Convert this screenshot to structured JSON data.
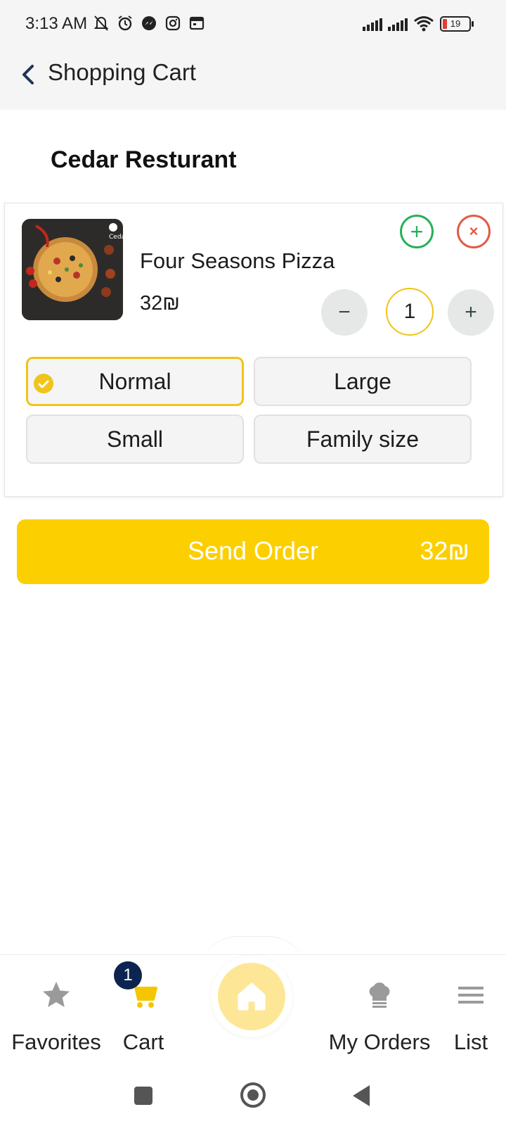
{
  "status_bar": {
    "time": "3:13 AM",
    "icons_left": [
      "bell-off-icon",
      "alarm-icon",
      "messenger-icon",
      "instagram-icon",
      "calendar-icon"
    ],
    "battery": "19"
  },
  "header": {
    "title": "Shopping Cart",
    "back_icon": "chevron-left-icon"
  },
  "restaurant": {
    "name": "Cedar Resturant"
  },
  "cart_item": {
    "name": "Four Seasons Pizza",
    "price": "32₪",
    "quantity": "1",
    "minus_label": "−",
    "plus_label": "+",
    "add_label": "+",
    "remove_label": "×",
    "image_logo": "Cedar",
    "sizes": [
      {
        "label": "Normal",
        "selected": true
      },
      {
        "label": "Large",
        "selected": false
      },
      {
        "label": "Small",
        "selected": false
      },
      {
        "label": "Family size",
        "selected": false
      }
    ]
  },
  "send_order": {
    "label": "Send Order",
    "total": "32₪"
  },
  "bottom_nav": {
    "cart_badge": "1",
    "items": [
      {
        "label": "Favorites",
        "icon": "star-icon"
      },
      {
        "label": "Cart",
        "icon": "cart-icon"
      },
      {
        "label": "",
        "icon": "home-icon"
      },
      {
        "label": "My Orders",
        "icon": "chef-hat-icon"
      },
      {
        "label": "List",
        "icon": "menu-icon"
      }
    ]
  },
  "colors": {
    "accent": "#fccf00",
    "selected_border": "#f0c419",
    "badge": "#0d2451",
    "add_green": "#27b05d",
    "remove_red": "#e35a47"
  }
}
